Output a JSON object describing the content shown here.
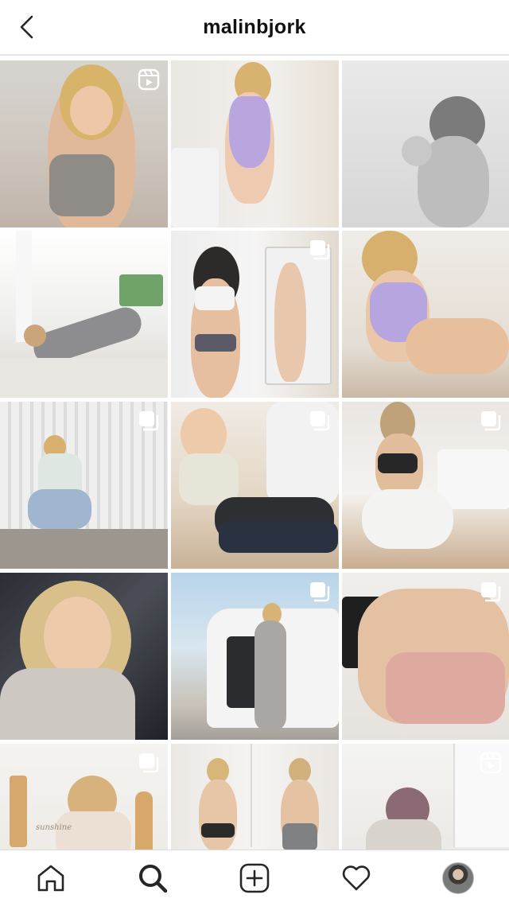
{
  "header": {
    "title": "malinbjork"
  },
  "icons": {
    "back": "chevron-left-icon",
    "reel": "reel-icon",
    "carousel": "carousel-icon",
    "home": "home-icon",
    "search": "search-icon",
    "new_post": "add-post-icon",
    "activity": "heart-icon",
    "profile": "avatar"
  },
  "grid": {
    "posts": [
      {
        "type": "reel",
        "badge": "reel-icon"
      },
      {
        "type": "photo",
        "badge": ""
      },
      {
        "type": "photo",
        "badge": ""
      },
      {
        "type": "reel",
        "badge": ""
      },
      {
        "type": "carousel",
        "badge": "carousel-icon"
      },
      {
        "type": "photo",
        "badge": ""
      },
      {
        "type": "carousel",
        "badge": "carousel-icon"
      },
      {
        "type": "carousel",
        "badge": "carousel-icon"
      },
      {
        "type": "carousel",
        "badge": "carousel-icon"
      },
      {
        "type": "photo",
        "badge": ""
      },
      {
        "type": "carousel",
        "badge": "carousel-icon"
      },
      {
        "type": "carousel",
        "badge": "carousel-icon"
      },
      {
        "type": "carousel",
        "badge": "carousel-icon"
      },
      {
        "type": "photo",
        "badge": ""
      },
      {
        "type": "reel",
        "badge": "reel-icon"
      }
    ],
    "captions": {
      "tile13": "sunshine"
    }
  },
  "colors": {
    "accent": "#262626",
    "divider": "#e6e6e6"
  }
}
